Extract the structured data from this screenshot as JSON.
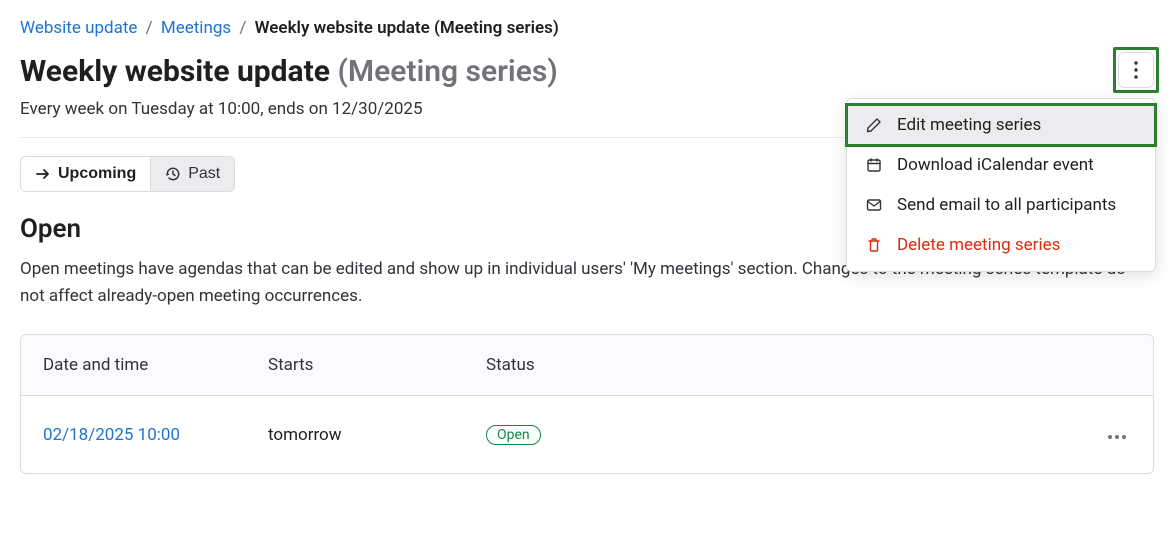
{
  "breadcrumb": {
    "root": "Website update",
    "middle": "Meetings",
    "current": "Weekly website update (Meeting series)"
  },
  "title": {
    "main": "Weekly website update",
    "suffix": "(Meeting series)"
  },
  "schedule": "Every week on Tuesday at 10:00, ends on 12/30/2025",
  "tabs": {
    "upcoming": "Upcoming",
    "past": "Past"
  },
  "section": {
    "heading": "Open",
    "description": "Open meetings have agendas that can be edited and show up in individual users' 'My meetings' section. Changes to the meeting series template do not affect already-open meeting occurrences."
  },
  "table": {
    "headers": {
      "date": "Date and time",
      "starts": "Starts",
      "status": "Status"
    },
    "rows": [
      {
        "date": "02/18/2025 10:00",
        "starts": "tomorrow",
        "status": "Open"
      }
    ]
  },
  "menu": {
    "edit": "Edit meeting series",
    "download": "Download iCalendar event",
    "email": "Send email to all participants",
    "delete": "Delete meeting series"
  },
  "colors": {
    "link": "#1f75cb",
    "success": "#108548",
    "danger": "#dd2b0e",
    "highlight": "#2e7d32"
  }
}
